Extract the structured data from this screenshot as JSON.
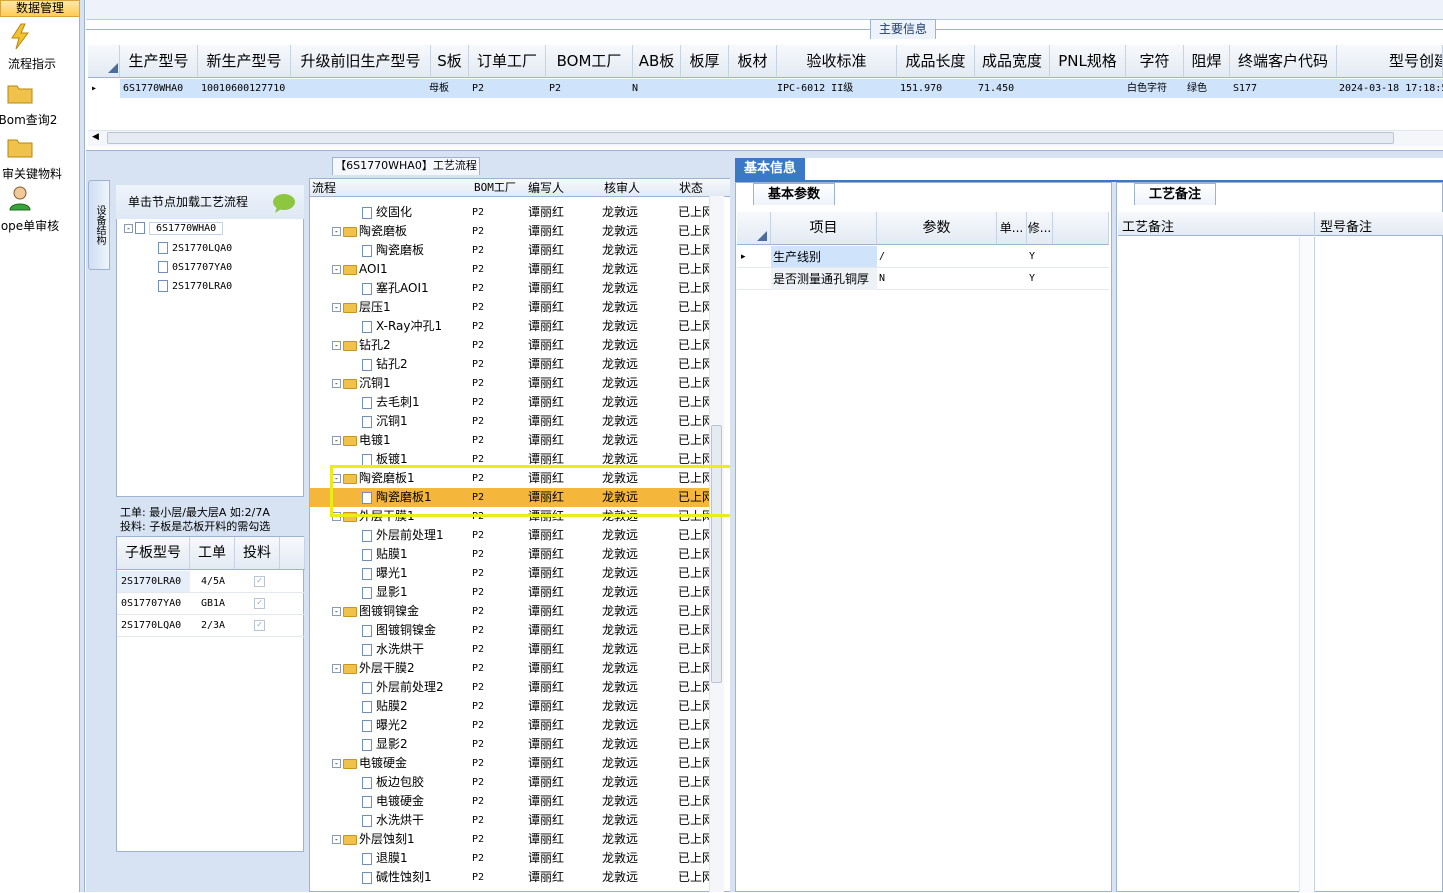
{
  "nav": {
    "header": "数据管理",
    "items": [
      {
        "label": "流程指示"
      },
      {
        "label": "Bom查询2"
      },
      {
        "label": "审关键物料"
      },
      {
        "label": "ope单审核"
      }
    ]
  },
  "top": {
    "section_title": "主要信息",
    "columns": [
      "生产型号",
      "新生产型号",
      "升级前旧生产型号",
      "S板",
      "订单工厂",
      "BOM工厂",
      "AB板",
      "板厚",
      "板材",
      "验收标准",
      "成品长度",
      "成品宽度",
      "PNL规格",
      "字符",
      "阻焊",
      "终端客户代码",
      "型号创建"
    ],
    "row": [
      "6S1770WHA0",
      "10010600127710",
      "",
      "母板",
      "P2",
      "P2",
      "N",
      "",
      "",
      "IPC-6012 II级",
      "151.970",
      "71.450",
      "",
      "白色字符",
      "绿色",
      "S177",
      "2024-03-18 17:18:5"
    ]
  },
  "process": {
    "title": "【6S1770WHA0】工艺流程",
    "side_tab": "设备结构",
    "tree_hint": "单击节点加载工艺流程",
    "tree": {
      "root": "6S1770WHA0",
      "children": [
        "2S1770LQA0",
        "0S17707YA0",
        "2S1770LRA0"
      ]
    },
    "note_line1": "工单: 最小层/最大层A 如:2/7A",
    "note_line2": "投料: 子板是芯板开料的需勾选",
    "sub_columns": [
      "子板型号",
      "工单",
      "投料"
    ],
    "sub_rows": [
      {
        "model": "2S1770LRA0",
        "order": "4/5A"
      },
      {
        "model": "0S17707YA0",
        "order": "GB1A"
      },
      {
        "model": "2S1770LQA0",
        "order": "2/3A"
      }
    ],
    "flow_columns": [
      "流程",
      "BOM工厂",
      "编写人",
      "核审人",
      "状态"
    ],
    "flow_rows": [
      {
        "name": "绞固化",
        "type": "doc",
        "factory": "P2",
        "writer": "谭丽红",
        "reviewer": "龙敦远",
        "status": "已上网"
      },
      {
        "name": "陶瓷磨板",
        "type": "folder",
        "factory": "P2",
        "writer": "谭丽红",
        "reviewer": "龙敦远",
        "status": "已上网"
      },
      {
        "name": "陶瓷磨板",
        "type": "doc",
        "factory": "P2",
        "writer": "谭丽红",
        "reviewer": "龙敦远",
        "status": "已上网"
      },
      {
        "name": "AOI1",
        "type": "folder",
        "factory": "P2",
        "writer": "谭丽红",
        "reviewer": "龙敦远",
        "status": "已上网"
      },
      {
        "name": "塞孔AOI1",
        "type": "doc",
        "factory": "P2",
        "writer": "谭丽红",
        "reviewer": "龙敦远",
        "status": "已上网"
      },
      {
        "name": "层压1",
        "type": "folder",
        "factory": "P2",
        "writer": "谭丽红",
        "reviewer": "龙敦远",
        "status": "已上网"
      },
      {
        "name": "X-Ray冲孔1",
        "type": "doc",
        "factory": "P2",
        "writer": "谭丽红",
        "reviewer": "龙敦远",
        "status": "已上网"
      },
      {
        "name": "钻孔2",
        "type": "folder",
        "factory": "P2",
        "writer": "谭丽红",
        "reviewer": "龙敦远",
        "status": "已上网"
      },
      {
        "name": "钻孔2",
        "type": "doc",
        "factory": "P2",
        "writer": "谭丽红",
        "reviewer": "龙敦远",
        "status": "已上网"
      },
      {
        "name": "沉铜1",
        "type": "folder",
        "factory": "P2",
        "writer": "谭丽红",
        "reviewer": "龙敦远",
        "status": "已上网"
      },
      {
        "name": "去毛刺1",
        "type": "doc",
        "factory": "P2",
        "writer": "谭丽红",
        "reviewer": "龙敦远",
        "status": "已上网"
      },
      {
        "name": "沉铜1",
        "type": "doc",
        "factory": "P2",
        "writer": "谭丽红",
        "reviewer": "龙敦远",
        "status": "已上网"
      },
      {
        "name": "电镀1",
        "type": "folder",
        "factory": "P2",
        "writer": "谭丽红",
        "reviewer": "龙敦远",
        "status": "已上网"
      },
      {
        "name": "板镀1",
        "type": "doc",
        "factory": "P2",
        "writer": "谭丽红",
        "reviewer": "龙敦远",
        "status": "已上网"
      },
      {
        "name": "陶瓷磨板1",
        "type": "folder",
        "factory": "P2",
        "writer": "谭丽红",
        "reviewer": "龙敦远",
        "status": "已上网"
      },
      {
        "name": "陶瓷磨板1",
        "type": "doc",
        "factory": "P2",
        "writer": "谭丽红",
        "reviewer": "龙敦远",
        "status": "已上网",
        "selected": true
      },
      {
        "name": "外层干膜1",
        "type": "folder",
        "factory": "P2",
        "writer": "谭丽红",
        "reviewer": "龙敦远",
        "status": "已上网"
      },
      {
        "name": "外层前处理1",
        "type": "doc",
        "factory": "P2",
        "writer": "谭丽红",
        "reviewer": "龙敦远",
        "status": "已上网"
      },
      {
        "name": "贴膜1",
        "type": "doc",
        "factory": "P2",
        "writer": "谭丽红",
        "reviewer": "龙敦远",
        "status": "已上网"
      },
      {
        "name": "曝光1",
        "type": "doc",
        "factory": "P2",
        "writer": "谭丽红",
        "reviewer": "龙敦远",
        "status": "已上网"
      },
      {
        "name": "显影1",
        "type": "doc",
        "factory": "P2",
        "writer": "谭丽红",
        "reviewer": "龙敦远",
        "status": "已上网"
      },
      {
        "name": "图镀铜镍金",
        "type": "folder",
        "factory": "P2",
        "writer": "谭丽红",
        "reviewer": "龙敦远",
        "status": "已上网"
      },
      {
        "name": "图镀铜镍金",
        "type": "doc",
        "factory": "P2",
        "writer": "谭丽红",
        "reviewer": "龙敦远",
        "status": "已上网"
      },
      {
        "name": "水洗烘干",
        "type": "doc",
        "factory": "P2",
        "writer": "谭丽红",
        "reviewer": "龙敦远",
        "status": "已上网"
      },
      {
        "name": "外层干膜2",
        "type": "folder",
        "factory": "P2",
        "writer": "谭丽红",
        "reviewer": "龙敦远",
        "status": "已上网"
      },
      {
        "name": "外层前处理2",
        "type": "doc",
        "factory": "P2",
        "writer": "谭丽红",
        "reviewer": "龙敦远",
        "status": "已上网"
      },
      {
        "name": "贴膜2",
        "type": "doc",
        "factory": "P2",
        "writer": "谭丽红",
        "reviewer": "龙敦远",
        "status": "已上网"
      },
      {
        "name": "曝光2",
        "type": "doc",
        "factory": "P2",
        "writer": "谭丽红",
        "reviewer": "龙敦远",
        "status": "已上网"
      },
      {
        "name": "显影2",
        "type": "doc",
        "factory": "P2",
        "writer": "谭丽红",
        "reviewer": "龙敦远",
        "status": "已上网"
      },
      {
        "name": "电镀硬金",
        "type": "folder",
        "factory": "P2",
        "writer": "谭丽红",
        "reviewer": "龙敦远",
        "status": "已上网"
      },
      {
        "name": "板边包胶",
        "type": "doc",
        "factory": "P2",
        "writer": "谭丽红",
        "reviewer": "龙敦远",
        "status": "已上网"
      },
      {
        "name": "电镀硬金",
        "type": "doc",
        "factory": "P2",
        "writer": "谭丽红",
        "reviewer": "龙敦远",
        "status": "已上网"
      },
      {
        "name": "水洗烘干",
        "type": "doc",
        "factory": "P2",
        "writer": "谭丽红",
        "reviewer": "龙敦远",
        "status": "已上网"
      },
      {
        "name": "外层蚀刻1",
        "type": "folder",
        "factory": "P2",
        "writer": "谭丽红",
        "reviewer": "龙敦远",
        "status": "已上网"
      },
      {
        "name": "退膜1",
        "type": "doc",
        "factory": "P2",
        "writer": "谭丽红",
        "reviewer": "龙敦远",
        "status": "已上网"
      },
      {
        "name": "碱性蚀刻1",
        "type": "doc",
        "factory": "P2",
        "writer": "谭丽红",
        "reviewer": "龙敦远",
        "status": "已上网"
      }
    ]
  },
  "basic": {
    "tab": "基本信息",
    "param_tab": "基本参数",
    "param_columns": [
      "项目",
      "参数",
      "单...",
      "修..."
    ],
    "param_rows": [
      {
        "item": "生产线别",
        "value": "/",
        "unit": "",
        "mod": "Y"
      },
      {
        "item": "是否测量通孔铜厚",
        "value": "N",
        "unit": "",
        "mod": "Y"
      }
    ],
    "craft_tab": "工艺备注",
    "craft_columns": [
      "工艺备注",
      "型号备注"
    ]
  },
  "colors": {
    "accent": "#3b78c8",
    "row_selected": "#cfe3fb",
    "highlight_box": "#ecec1a"
  }
}
